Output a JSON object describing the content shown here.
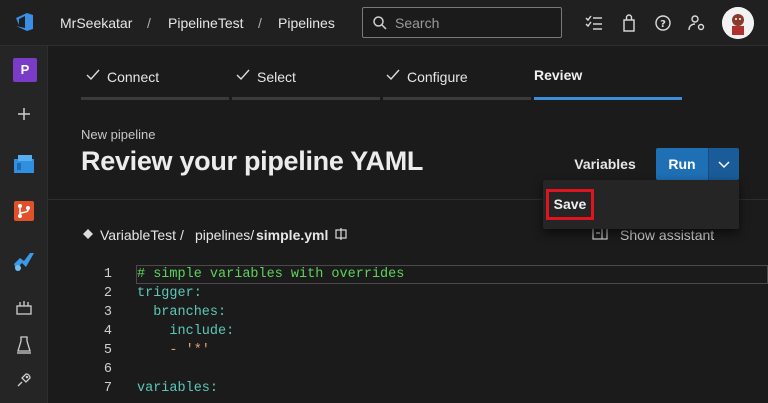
{
  "header": {
    "breadcrumb": [
      "MrSeekatar",
      "PipelineTest",
      "Pipelines"
    ],
    "search_placeholder": "Search"
  },
  "leftnav": {
    "project_initial": "P",
    "items": [
      "add-icon",
      "boards-icon",
      "repos-icon",
      "pipelines-icon",
      "test-plans-icon",
      "artifacts-icon",
      "extensions-icon"
    ]
  },
  "wizard": {
    "steps": [
      "Connect",
      "Select",
      "Configure",
      "Review"
    ],
    "active_step": "Review"
  },
  "page": {
    "subtitle": "New pipeline",
    "title": "Review your pipeline YAML",
    "variables_label": "Variables",
    "run_label": "Run",
    "dropdown": {
      "save_label": "Save"
    }
  },
  "file": {
    "repo": "VariableTest",
    "sep": "/",
    "folder": "pipelines/",
    "filename": "simple.yml",
    "show_assistant_label": "Show assistant"
  },
  "editor": {
    "lines": [
      {
        "num": "1",
        "text": "# simple variables with overrides"
      },
      {
        "num": "2",
        "text": "trigger:"
      },
      {
        "num": "3",
        "text": "  branches:"
      },
      {
        "num": "4",
        "text": "    include:"
      },
      {
        "num": "5",
        "text": "    - '*'"
      },
      {
        "num": "6",
        "text": ""
      },
      {
        "num": "7",
        "text": "variables:"
      }
    ]
  },
  "colors": {
    "accent": "#1f6fb5",
    "active_step_bar": "#3c8ed8",
    "highlight_box": "#e0141e",
    "comment": "#5dd35d",
    "yaml_key": "#5cc8b8"
  }
}
